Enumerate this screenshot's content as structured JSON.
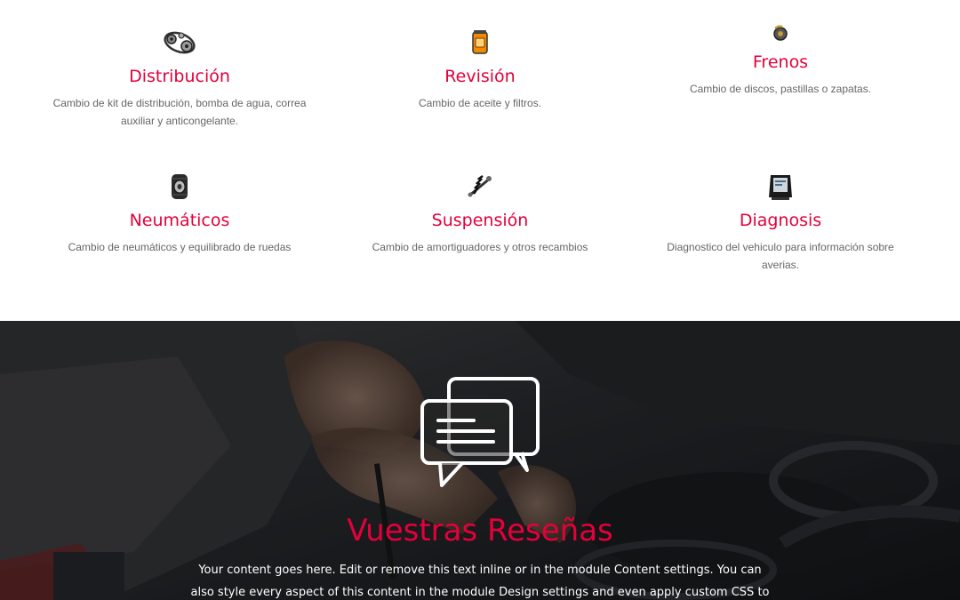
{
  "services": [
    {
      "icon": "timing-belt-icon",
      "title": "Distribución",
      "description": "Cambio de kit de distribución, bomba de agua, correa auxiliar y anticongelante."
    },
    {
      "icon": "oil-filter-icon",
      "title": "Revisión",
      "description": "Cambio de aceite y filtros."
    },
    {
      "icon": "brake-disc-icon",
      "title": "Frenos",
      "description": "Cambio de discos, pastillas o zapatas."
    },
    {
      "icon": "tires-icon",
      "title": "Neumáticos",
      "description": "Cambio de neumáticos y equilibrado de ruedas"
    },
    {
      "icon": "shock-absorber-icon",
      "title": "Suspensión",
      "description": "Cambio de amortiguadores y otros recambios"
    },
    {
      "icon": "diagnostic-screen-icon",
      "title": "Diagnosis",
      "description": "Diagnostico del vehiculo para información sobre averias."
    }
  ],
  "reviews": {
    "icon": "chat-bubbles-icon",
    "heading": "Vuestras Reseñas",
    "body": "Your content goes here. Edit or remove this text inline or in the module Content settings. You can also style every aspect of this content in the module Design settings and even apply custom CSS to this text in the"
  },
  "colors": {
    "accent": "#e4003a",
    "text_gray": "#666666",
    "dark_bg": "#222528"
  }
}
